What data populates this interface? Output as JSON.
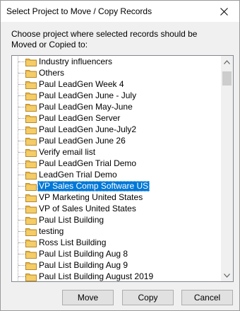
{
  "window": {
    "title": "Select Project to Move / Copy Records",
    "close_glyph": "✕"
  },
  "instructions": "Choose project where selected records should be Moved or Copied to:",
  "tree": {
    "selected_index": 11,
    "items": [
      {
        "label": "Industry influencers"
      },
      {
        "label": "Others"
      },
      {
        "label": "Paul LeadGen Week 4"
      },
      {
        "label": "Paul LeadGen June - July"
      },
      {
        "label": "Paul LeadGen May-June"
      },
      {
        "label": "Paul LeadGen Server"
      },
      {
        "label": "Paul LeadGen June-July2"
      },
      {
        "label": "Paul LeadGen June 26"
      },
      {
        "label": "Verify email list"
      },
      {
        "label": "Paul LeadGen Trial Demo"
      },
      {
        "label": "LeadGen Trial Demo"
      },
      {
        "label": "VP Sales Comp Software US"
      },
      {
        "label": "VP Marketing United States"
      },
      {
        "label": "VP of Sales United States"
      },
      {
        "label": "Paul List Building"
      },
      {
        "label": "testing"
      },
      {
        "label": "Ross List Building"
      },
      {
        "label": "Paul List Building Aug 8"
      },
      {
        "label": "Paul List Building Aug 9"
      },
      {
        "label": "Paul List Building August 2019"
      }
    ],
    "icon": "folder-icon"
  },
  "scrollbar": {
    "up_glyph": "▲",
    "down_glyph": "▼",
    "position_fraction": 0.0
  },
  "buttons": {
    "move": "Move",
    "copy": "Copy",
    "cancel": "Cancel"
  },
  "colors": {
    "selection": "#0078d7",
    "folder": "#e8b84a",
    "dialog_bg": "#f0f0f0"
  }
}
